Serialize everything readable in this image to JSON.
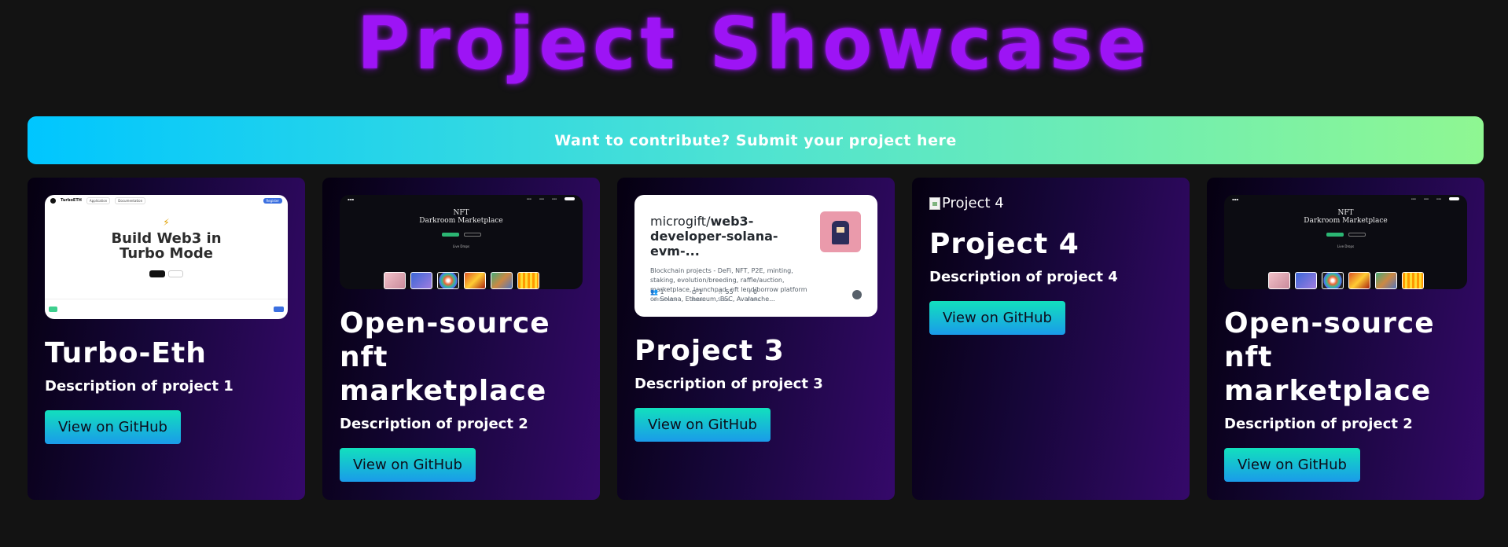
{
  "page_title": "Project Showcase",
  "contribute": {
    "label": "Want to contribute? Submit your project here"
  },
  "projects": [
    {
      "title": "Turbo-Eth",
      "description": "Description of project 1",
      "button": "View on GitHub",
      "thumbnail": {
        "brand": "TurboETH",
        "nav_item_1": "Application",
        "nav_item_2": "Documentation",
        "nav_button": "Register",
        "hero_line1": "Build Web3 in",
        "hero_line2": "Turbo Mode"
      }
    },
    {
      "title": "Open-source nft marketplace",
      "description": "Description of project 2",
      "button": "View on GitHub",
      "thumbnail": {
        "heading_line1": "NFT",
        "heading_line2": "Darkroom Marketplace",
        "live_label": "Live Drops"
      }
    },
    {
      "title": "Project 3",
      "description": "Description of project 3",
      "button": "View on GitHub",
      "thumbnail": {
        "repo_owner": "microgift/",
        "repo_name": "web3-developer-solana-evm-...",
        "repo_description": "Blockchain projects - DeFi, NFT, P2E, minting, staking, evolution/breeding, raffle/auction, marketplace, launchpad, nft lend/borrow platform on Solana, Ethereum, BSC, Avalanche...",
        "stats": [
          {
            "value": "1",
            "label": "Contributor"
          },
          {
            "value": "1",
            "label": "Issue"
          },
          {
            "value": "55",
            "label": "Stars"
          },
          {
            "value": "0",
            "label": "Forks"
          }
        ]
      }
    },
    {
      "title": "Project 4",
      "description": "Description of project 4",
      "button": "View on GitHub",
      "image_alt": "Project 4"
    },
    {
      "title": "Open-source nft marketplace",
      "description": "Description of project 2",
      "button": "View on GitHub",
      "thumbnail": {
        "heading_line1": "NFT",
        "heading_line2": "Darkroom Marketplace",
        "live_label": "Live Drops"
      }
    }
  ],
  "colors": {
    "background": "#131313",
    "title": "#9d14f5",
    "banner_gradient": [
      "#00c6ff",
      "#8ff792"
    ],
    "card_gradient": [
      "#050010",
      "#35096a"
    ],
    "button_gradient": [
      "#12e0bd",
      "#1a9bea"
    ]
  }
}
